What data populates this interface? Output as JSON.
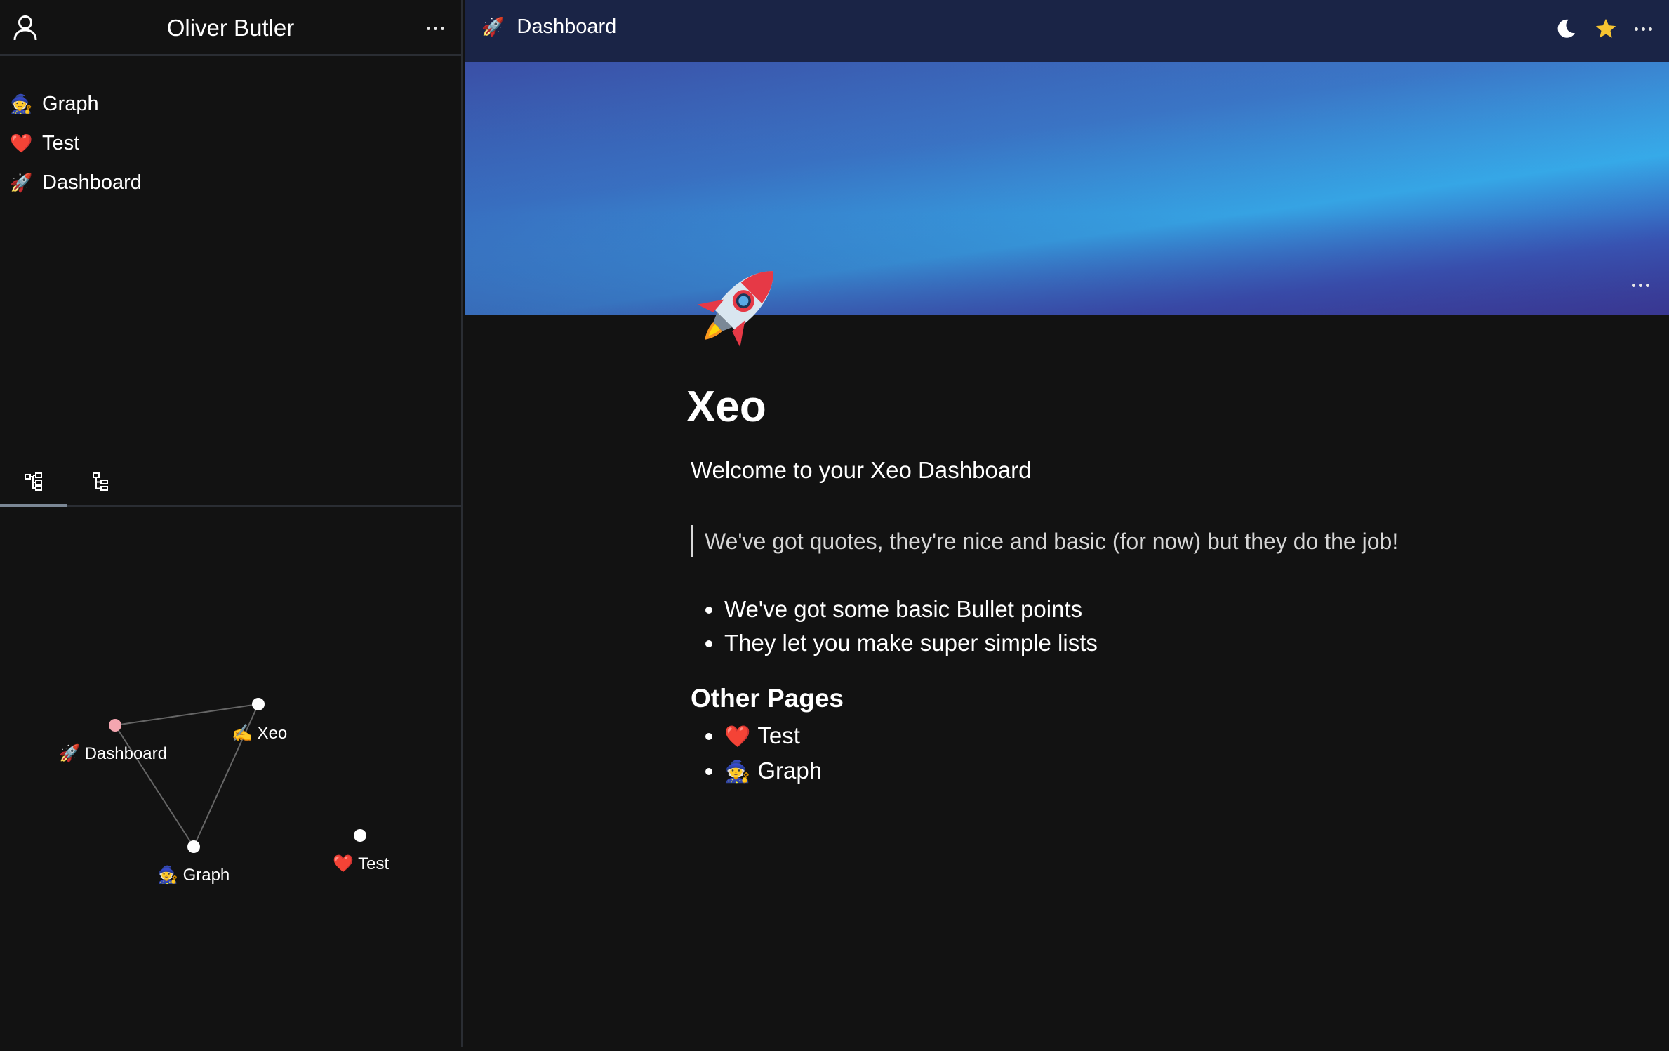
{
  "sidebar": {
    "user_name": "Oliver Butler",
    "items": [
      {
        "emoji": "🧙",
        "label": "Graph"
      },
      {
        "emoji": "❤️",
        "label": "Test"
      },
      {
        "emoji": "🚀",
        "label": "Dashboard"
      }
    ]
  },
  "graph": {
    "nodes": [
      {
        "emoji": "🚀",
        "label": "Dashboard"
      },
      {
        "emoji": "✍️",
        "label": "Xeo"
      },
      {
        "emoji": "🧙",
        "label": "Graph"
      },
      {
        "emoji": "❤️",
        "label": "Test"
      }
    ]
  },
  "topbar": {
    "breadcrumb_emoji": "🚀",
    "breadcrumb_label": "Dashboard"
  },
  "page": {
    "icon": "🚀",
    "title": "Xeo",
    "welcome": "Welcome to your Xeo Dashboard",
    "quote": "We've got quotes, they're nice and basic (for now) but they do the job!",
    "bullets": [
      "We've got some basic Bullet points",
      "They let you make super simple lists"
    ],
    "other_pages_heading": "Other Pages",
    "other_pages": [
      {
        "emoji": "❤️",
        "label": "Test"
      },
      {
        "emoji": "🧙",
        "label": "Graph"
      }
    ]
  },
  "colors": {
    "background": "#121212",
    "topbar": "#1a2446",
    "star": "#f6c431",
    "dashboard_node": "#f4a6b0"
  }
}
